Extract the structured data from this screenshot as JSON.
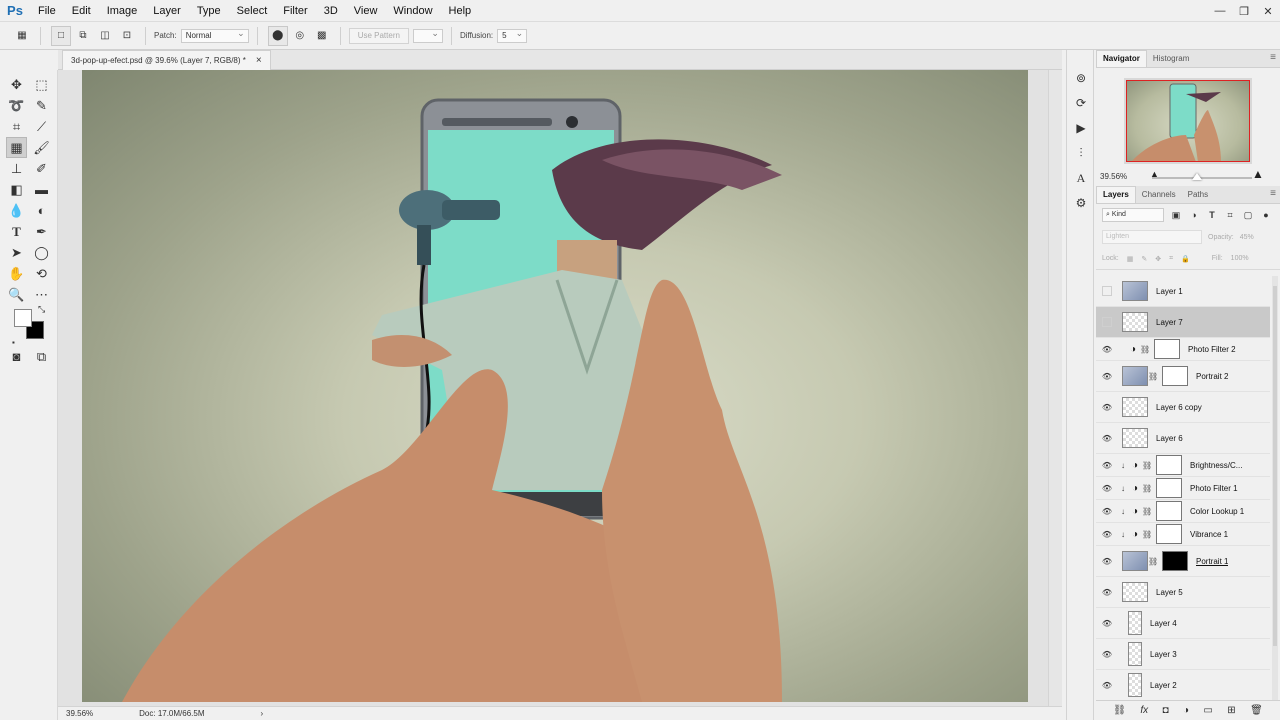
{
  "app": {
    "logo": "Ps"
  },
  "menu": [
    "File",
    "Edit",
    "Image",
    "Layer",
    "Type",
    "Select",
    "Filter",
    "3D",
    "View",
    "Window",
    "Help"
  ],
  "window_controls": {
    "minimize": "—",
    "restore": "❐",
    "close": "✕"
  },
  "options": {
    "patch_label": "Patch:",
    "patch_value": "Normal",
    "use_pattern": "Use Pattern",
    "diffusion_label": "Diffusion:",
    "diffusion_value": "5"
  },
  "document": {
    "tab_title": "3d-pop-up-efect.psd @ 39.6% (Layer 7, RGB/8) *",
    "close": "×"
  },
  "status": {
    "zoom": "39.56%",
    "doc": "Doc: 17.0M/66.5M",
    "arrow": "›"
  },
  "navigator": {
    "tabs": [
      "Navigator",
      "Histogram"
    ],
    "zoom": "39.56%"
  },
  "layers_panel": {
    "tabs": [
      "Layers",
      "Channels",
      "Paths"
    ],
    "kind": "Kind",
    "blend_mode": "Lighten",
    "opacity_label": "Opacity:",
    "opacity_value": "45%",
    "lock_label": "Lock:",
    "fill_label": "Fill:",
    "fill_value": "100%",
    "layers": [
      {
        "name": "Layer 1",
        "visible": false,
        "type": "photo"
      },
      {
        "name": "Layer 7",
        "visible": false,
        "type": "transparent",
        "selected": true
      },
      {
        "name": "Photo Filter 2",
        "visible": true,
        "type": "adjustment"
      },
      {
        "name": "Portrait 2",
        "visible": true,
        "type": "photo-mask"
      },
      {
        "name": "Layer 6 copy",
        "visible": true,
        "type": "transparent"
      },
      {
        "name": "Layer 6",
        "visible": true,
        "type": "transparent"
      },
      {
        "name": "Brightness/C...",
        "visible": true,
        "type": "adjustment-clip"
      },
      {
        "name": "Photo Filter 1",
        "visible": true,
        "type": "adjustment-clip"
      },
      {
        "name": "Color Lookup 1",
        "visible": true,
        "type": "adjustment-clip"
      },
      {
        "name": "Vibrance 1",
        "visible": true,
        "type": "adjustment-clip"
      },
      {
        "name": "Portrait 1",
        "visible": true,
        "type": "photo-mask-black"
      },
      {
        "name": "Layer 5",
        "visible": true,
        "type": "transparent"
      },
      {
        "name": "Layer 4",
        "visible": true,
        "type": "transparent-tall"
      },
      {
        "name": "Layer 3",
        "visible": true,
        "type": "transparent-tall"
      },
      {
        "name": "Layer 2",
        "visible": true,
        "type": "transparent-tall"
      }
    ]
  },
  "colors": {
    "accent": "#1f6fb4",
    "panel_bg": "#f0f0f0",
    "selected_layer": "#c9c9c9"
  }
}
